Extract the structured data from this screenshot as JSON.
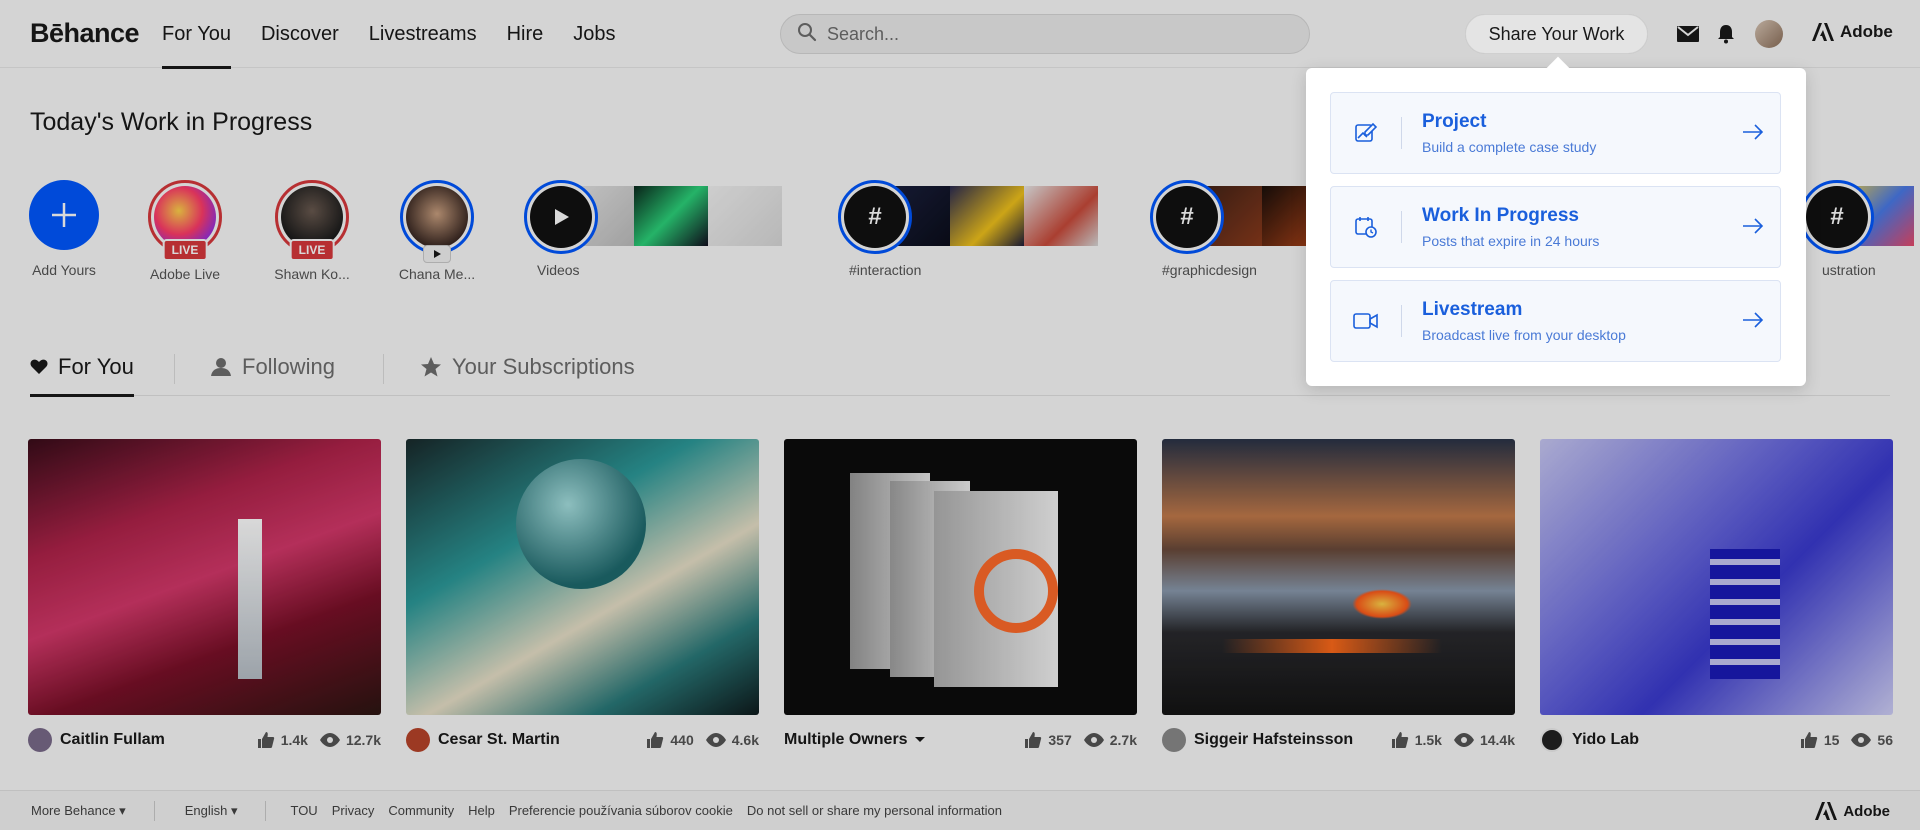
{
  "nav": {
    "logo": "Bēhance",
    "links": [
      "For You",
      "Discover",
      "Livestreams",
      "Hire",
      "Jobs"
    ],
    "search_placeholder": "Search...",
    "share_label": "Share Your Work",
    "brand": "Adobe"
  },
  "wip": {
    "title": "Today's Work in Progress",
    "stories": [
      {
        "label": "Add Yours"
      },
      {
        "label": "Adobe Live",
        "badge": "LIVE"
      },
      {
        "label": "Shawn Ko...",
        "badge": "LIVE"
      },
      {
        "label": "Chana Me..."
      },
      {
        "label": "Videos"
      },
      {
        "label": "#interaction"
      },
      {
        "label": "#graphicdesign"
      },
      {
        "label": "ustration"
      }
    ],
    "hash_symbol": "#"
  },
  "tabs": [
    {
      "label": "For You",
      "icon": "heart-icon"
    },
    {
      "label": "Following",
      "icon": "person-icon"
    },
    {
      "label": "Your Subscriptions",
      "icon": "star-icon"
    }
  ],
  "projects": [
    {
      "owner": "Caitlin Fullam",
      "likes": "1.4k",
      "views": "12.7k"
    },
    {
      "owner": "Cesar St. Martin",
      "likes": "440",
      "views": "4.6k"
    },
    {
      "owner": "Multiple Owners",
      "likes": "357",
      "views": "2.7k"
    },
    {
      "owner": "Siggeir Hafsteinsson",
      "likes": "1.5k",
      "views": "14.4k"
    },
    {
      "owner": "Yido Lab",
      "likes": "15",
      "views": "56"
    }
  ],
  "dropdown": {
    "items": [
      {
        "title": "Project",
        "subtitle": "Build a complete case study",
        "icon": "edit-image-icon"
      },
      {
        "title": "Work In Progress",
        "subtitle": "Posts that expire in 24 hours",
        "icon": "calendar-clock-icon"
      },
      {
        "title": "Livestream",
        "subtitle": "Broadcast live from your desktop",
        "icon": "video-camera-icon"
      }
    ]
  },
  "footer": {
    "more": "More Behance",
    "language": "English",
    "links": [
      "TOU",
      "Privacy",
      "Community",
      "Help",
      "Preferencie používania súborov cookie",
      "Do not sell or share my personal information"
    ],
    "brand": "Adobe"
  }
}
